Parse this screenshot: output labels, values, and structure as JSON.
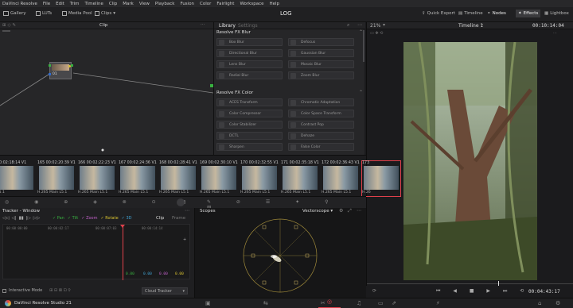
{
  "menubar": {
    "items": [
      "DaVinci Resolve",
      "File",
      "Edit",
      "Trim",
      "Timeline",
      "Clip",
      "Mark",
      "View",
      "Playback",
      "Fusion",
      "Color",
      "Fairlight",
      "Workspace",
      "Help"
    ]
  },
  "toolbar": {
    "left": [
      {
        "label": "Gallery",
        "icon": "gallery-icon"
      },
      {
        "label": "LUTs",
        "icon": "luts-icon"
      },
      {
        "label": "Media Pool",
        "icon": "media-pool-icon"
      },
      {
        "label": "Clips",
        "icon": "clips-icon"
      }
    ],
    "title": "LOG",
    "right": [
      {
        "label": "Quick Export",
        "icon": "export-icon"
      },
      {
        "label": "Timeline",
        "icon": "timeline-icon"
      },
      {
        "label": "Nodes",
        "icon": "nodes-icon"
      },
      {
        "label": "Effects",
        "icon": "effects-icon"
      },
      {
        "label": "Lightbox",
        "icon": "lightbox-icon"
      }
    ]
  },
  "node_editor": {
    "header_label": "Clip",
    "node_label": "01"
  },
  "library": {
    "tabs": [
      "Library",
      "Settings"
    ],
    "sections": [
      {
        "title": "Resolve FX Blur",
        "items": [
          "Box Blur",
          "Directional Blur",
          "Lens Blur",
          "Radial Blur",
          "Defocus",
          "Gaussian Blur",
          "Mosaic Blur",
          "Zoom Blur"
        ]
      },
      {
        "title": "Resolve FX Color",
        "items": [
          "ACES Transform",
          "Color Compressor",
          "Color Stabilizer",
          "DCTL",
          "Sharpen",
          "Chromatic Adaptation",
          "Color Space Transform",
          "Contrast Pop",
          "Dehaze",
          "False Color"
        ]
      }
    ]
  },
  "viewer": {
    "zoom": "21%",
    "timeline": "Timeline 1",
    "timecode": "00:10:14:04",
    "footer_timecode": "00:04:43:17"
  },
  "thumbs": [
    {
      "num": "",
      "tc": "00:02:18:14",
      "track": "V1",
      "caption": "L5.1"
    },
    {
      "num": "165",
      "tc": "00:02:20:39",
      "track": "V1",
      "caption": "H.265 Main L5.1"
    },
    {
      "num": "166",
      "tc": "00:02:22:23",
      "track": "V1",
      "caption": "H.265 Main L5.1"
    },
    {
      "num": "167",
      "tc": "00:02:24:36",
      "track": "V1",
      "caption": "H.265 Main L5.1"
    },
    {
      "num": "168",
      "tc": "00:02:28:41",
      "track": "V1",
      "caption": "H.265 Main L5.1"
    },
    {
      "num": "169",
      "tc": "00:02:30:10",
      "track": "V1",
      "caption": "H.265 Main L5.1"
    },
    {
      "num": "170",
      "tc": "00:02:32:55",
      "track": "V1",
      "caption": "H.265 Main L5.1"
    },
    {
      "num": "171",
      "tc": "00:02:35:18",
      "track": "V1",
      "caption": "H.265 Main L5.1"
    },
    {
      "num": "172",
      "tc": "00:02:36:43",
      "track": "V1",
      "caption": "H.265 Main L5.1"
    },
    {
      "num": "173",
      "tc": "",
      "track": "",
      "caption": "H.26"
    }
  ],
  "tracker": {
    "title": "Tracker - Window",
    "options": [
      "Pan",
      "Tilt",
      "Zoom",
      "Rotate",
      "3D"
    ],
    "tabs": [
      "Clip",
      "Frame"
    ],
    "ruler": [
      "00:00:00:00",
      "00:00:02:17",
      "00:00:07:03",
      "00:00:14:14"
    ],
    "values": [
      "0.00",
      "0.00",
      "0.00",
      "0.00",
      "0.00"
    ],
    "mode": "Interactive Mode",
    "cloud": "Cloud Tracker"
  },
  "scopes": {
    "title": "Scopes",
    "mode": "Vectorscope"
  },
  "footer": {
    "app": "DaVinci Resolve Studio 21"
  },
  "colors": {
    "accent": "#e0404b",
    "panel": "#262628",
    "bg": "#1a1a1c"
  }
}
